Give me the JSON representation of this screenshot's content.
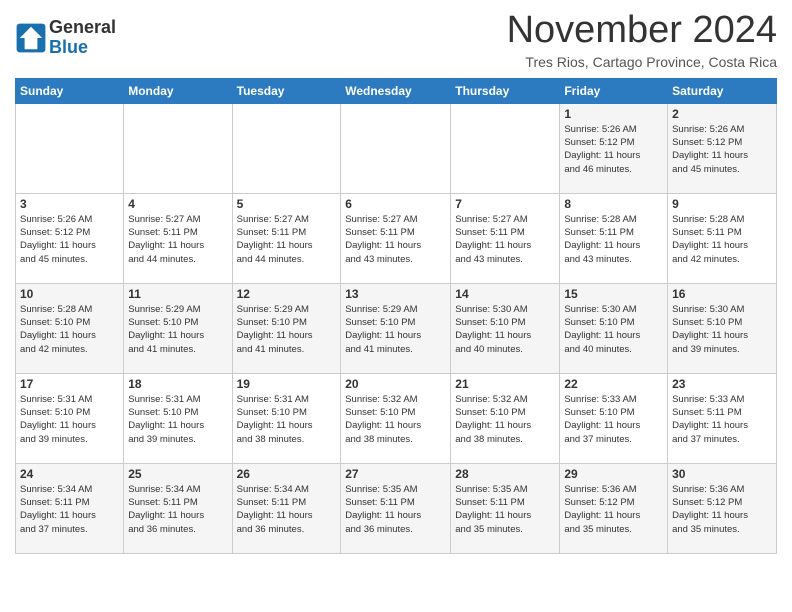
{
  "logo": {
    "line1": "General",
    "line2": "Blue"
  },
  "title": "November 2024",
  "subtitle": "Tres Rios, Cartago Province, Costa Rica",
  "days_header": [
    "Sunday",
    "Monday",
    "Tuesday",
    "Wednesday",
    "Thursday",
    "Friday",
    "Saturday"
  ],
  "weeks": [
    [
      {
        "day": "",
        "info": ""
      },
      {
        "day": "",
        "info": ""
      },
      {
        "day": "",
        "info": ""
      },
      {
        "day": "",
        "info": ""
      },
      {
        "day": "",
        "info": ""
      },
      {
        "day": "1",
        "info": "Sunrise: 5:26 AM\nSunset: 5:12 PM\nDaylight: 11 hours\nand 46 minutes."
      },
      {
        "day": "2",
        "info": "Sunrise: 5:26 AM\nSunset: 5:12 PM\nDaylight: 11 hours\nand 45 minutes."
      }
    ],
    [
      {
        "day": "3",
        "info": "Sunrise: 5:26 AM\nSunset: 5:12 PM\nDaylight: 11 hours\nand 45 minutes."
      },
      {
        "day": "4",
        "info": "Sunrise: 5:27 AM\nSunset: 5:11 PM\nDaylight: 11 hours\nand 44 minutes."
      },
      {
        "day": "5",
        "info": "Sunrise: 5:27 AM\nSunset: 5:11 PM\nDaylight: 11 hours\nand 44 minutes."
      },
      {
        "day": "6",
        "info": "Sunrise: 5:27 AM\nSunset: 5:11 PM\nDaylight: 11 hours\nand 43 minutes."
      },
      {
        "day": "7",
        "info": "Sunrise: 5:27 AM\nSunset: 5:11 PM\nDaylight: 11 hours\nand 43 minutes."
      },
      {
        "day": "8",
        "info": "Sunrise: 5:28 AM\nSunset: 5:11 PM\nDaylight: 11 hours\nand 43 minutes."
      },
      {
        "day": "9",
        "info": "Sunrise: 5:28 AM\nSunset: 5:11 PM\nDaylight: 11 hours\nand 42 minutes."
      }
    ],
    [
      {
        "day": "10",
        "info": "Sunrise: 5:28 AM\nSunset: 5:10 PM\nDaylight: 11 hours\nand 42 minutes."
      },
      {
        "day": "11",
        "info": "Sunrise: 5:29 AM\nSunset: 5:10 PM\nDaylight: 11 hours\nand 41 minutes."
      },
      {
        "day": "12",
        "info": "Sunrise: 5:29 AM\nSunset: 5:10 PM\nDaylight: 11 hours\nand 41 minutes."
      },
      {
        "day": "13",
        "info": "Sunrise: 5:29 AM\nSunset: 5:10 PM\nDaylight: 11 hours\nand 41 minutes."
      },
      {
        "day": "14",
        "info": "Sunrise: 5:30 AM\nSunset: 5:10 PM\nDaylight: 11 hours\nand 40 minutes."
      },
      {
        "day": "15",
        "info": "Sunrise: 5:30 AM\nSunset: 5:10 PM\nDaylight: 11 hours\nand 40 minutes."
      },
      {
        "day": "16",
        "info": "Sunrise: 5:30 AM\nSunset: 5:10 PM\nDaylight: 11 hours\nand 39 minutes."
      }
    ],
    [
      {
        "day": "17",
        "info": "Sunrise: 5:31 AM\nSunset: 5:10 PM\nDaylight: 11 hours\nand 39 minutes."
      },
      {
        "day": "18",
        "info": "Sunrise: 5:31 AM\nSunset: 5:10 PM\nDaylight: 11 hours\nand 39 minutes."
      },
      {
        "day": "19",
        "info": "Sunrise: 5:31 AM\nSunset: 5:10 PM\nDaylight: 11 hours\nand 38 minutes."
      },
      {
        "day": "20",
        "info": "Sunrise: 5:32 AM\nSunset: 5:10 PM\nDaylight: 11 hours\nand 38 minutes."
      },
      {
        "day": "21",
        "info": "Sunrise: 5:32 AM\nSunset: 5:10 PM\nDaylight: 11 hours\nand 38 minutes."
      },
      {
        "day": "22",
        "info": "Sunrise: 5:33 AM\nSunset: 5:10 PM\nDaylight: 11 hours\nand 37 minutes."
      },
      {
        "day": "23",
        "info": "Sunrise: 5:33 AM\nSunset: 5:11 PM\nDaylight: 11 hours\nand 37 minutes."
      }
    ],
    [
      {
        "day": "24",
        "info": "Sunrise: 5:34 AM\nSunset: 5:11 PM\nDaylight: 11 hours\nand 37 minutes."
      },
      {
        "day": "25",
        "info": "Sunrise: 5:34 AM\nSunset: 5:11 PM\nDaylight: 11 hours\nand 36 minutes."
      },
      {
        "day": "26",
        "info": "Sunrise: 5:34 AM\nSunset: 5:11 PM\nDaylight: 11 hours\nand 36 minutes."
      },
      {
        "day": "27",
        "info": "Sunrise: 5:35 AM\nSunset: 5:11 PM\nDaylight: 11 hours\nand 36 minutes."
      },
      {
        "day": "28",
        "info": "Sunrise: 5:35 AM\nSunset: 5:11 PM\nDaylight: 11 hours\nand 35 minutes."
      },
      {
        "day": "29",
        "info": "Sunrise: 5:36 AM\nSunset: 5:12 PM\nDaylight: 11 hours\nand 35 minutes."
      },
      {
        "day": "30",
        "info": "Sunrise: 5:36 AM\nSunset: 5:12 PM\nDaylight: 11 hours\nand 35 minutes."
      }
    ]
  ]
}
